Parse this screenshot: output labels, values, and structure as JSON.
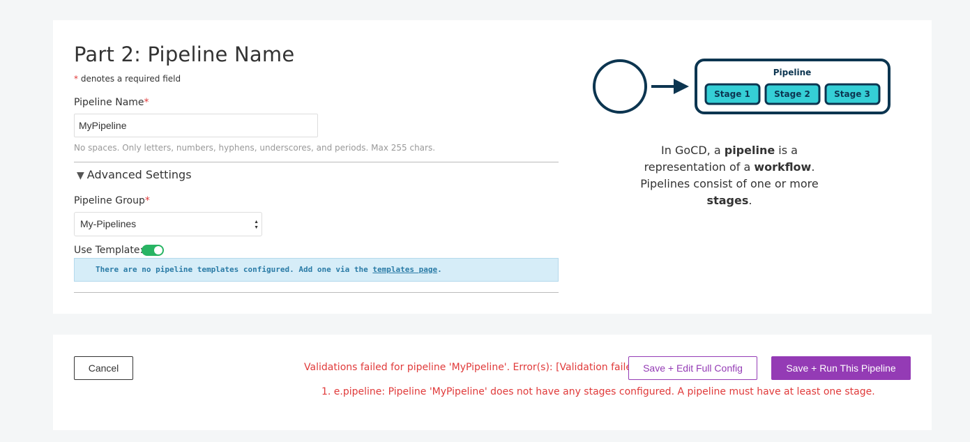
{
  "form": {
    "title": "Part 2: Pipeline Name",
    "required_star": "*",
    "required_note": "denotes a required field",
    "pipeline_name_label": "Pipeline Name",
    "pipeline_name_value": "MyPipeline",
    "pipeline_name_help": "No spaces. Only letters, numbers, hyphens, underscores, and periods. Max 255 chars.",
    "advanced_toggle_glyph": "▼",
    "advanced_label": "Advanced Settings",
    "pipeline_group_label": "Pipeline Group",
    "pipeline_group_value": "My-Pipelines",
    "use_template_label": "Use Template:",
    "use_template_on": true,
    "template_info_prefix": "There are no pipeline templates configured. Add one via the ",
    "template_info_link": "templates page",
    "template_info_suffix": "."
  },
  "diagram": {
    "pipeline_label": "Pipeline",
    "stages": [
      "Stage 1",
      "Stage 2",
      "Stage 3"
    ],
    "outline_color": "#0c3550",
    "stage_fill": "#35cfd6"
  },
  "description": {
    "p1": "In GoCD, a ",
    "b1": "pipeline",
    "p2": " is a representation of a ",
    "b2": "workflow",
    "p3": ". Pipelines consist of one or more ",
    "b3": "stages",
    "p4": "."
  },
  "footer": {
    "cancel_label": "Cancel",
    "error_line1": "Validations failed for pipeline 'MyPipeline'. Error(s): [Validation failed.]. Please correct and resubmit.",
    "error_line2": "1. e.pipeline: Pipeline 'MyPipeline' does not have any stages configured. A pipeline must have at least one stage.",
    "save_edit_label": "Save + Edit Full Config",
    "save_run_label": "Save + Run This Pipeline"
  },
  "colors": {
    "page_bg": "#f4f6f7",
    "error": "#e03a3a",
    "primary": "#943bb5",
    "toggle_on": "#28b463",
    "info_bg": "#d6edf8",
    "info_text": "#2a7ba6"
  }
}
